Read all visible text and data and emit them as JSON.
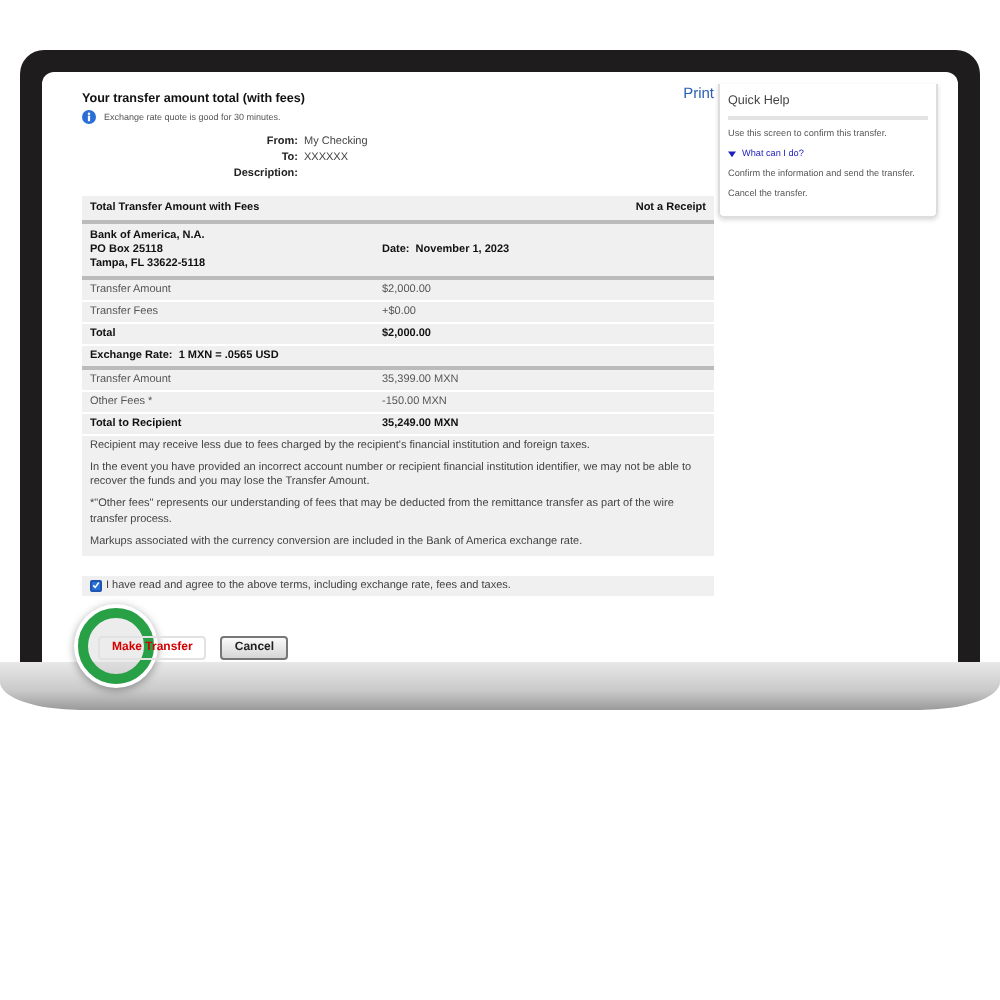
{
  "header": {
    "title": "Your transfer amount total (with fees)",
    "print_link": "Print",
    "notice": "Exchange rate quote is good for 30 minutes."
  },
  "parties": [
    {
      "label": "From:",
      "value": "My Checking"
    },
    {
      "label": "To:",
      "value": "XXXXXX"
    },
    {
      "label": "Description:"
    }
  ],
  "summary": {
    "title": "Total Transfer Amount with Fees",
    "tag": "Not a Receipt",
    "bank_lines": [
      "Bank of America, N.A.",
      "PO Box 25118",
      "Tampa, FL 33622-5118"
    ],
    "date": "Date:  November 1, 2023"
  },
  "rows": [
    {
      "kind": "line",
      "label": "Transfer Amount",
      "value": "$2,000.00"
    },
    {
      "kind": "line",
      "label": "Transfer Fees",
      "value": "+$0.00"
    },
    {
      "kind": "total",
      "label": "Total",
      "value": "$2,000.00"
    },
    {
      "kind": "section",
      "label": "Exchange Rate:  1 MXN = .0565 USD"
    },
    {
      "kind": "line",
      "label": "Transfer Amount",
      "value": "35,399.00 MXN"
    },
    {
      "kind": "line",
      "label": "Other Fees *",
      "value": "-150.00 MXN"
    },
    {
      "kind": "total",
      "label": "Total to Recipient",
      "value": "35,249.00 MXN"
    }
  ],
  "notes": [
    "Recipient may receive less due to fees charged by the recipient's financial institution and foreign taxes.",
    "In the event you have provided an incorrect account number or recipient financial institution identifier, we may not be able to recover the funds and you may lose the Transfer Amount.",
    "*\"Other fees\" represents our understanding of fees that may be deducted from the remittance transfer as part of the wire transfer process.",
    "Markups associated with the currency conversion are included in the Bank of America exchange rate."
  ],
  "agreement": {
    "checked": true,
    "label": "I have read and agree to the above terms, including exchange rate, fees and taxes."
  },
  "buttons": [
    {
      "kind": "primary",
      "label": "Make Transfer",
      "highlighted": true
    },
    {
      "kind": "secondary",
      "label": "Cancel",
      "highlighted": false
    }
  ],
  "quick_help": {
    "title": "Quick Help",
    "intro": "Use this screen to confirm this transfer.",
    "section": {
      "label": "What can I do?",
      "expanded": true
    },
    "items": [
      "Confirm the information and send the transfer.",
      "Cancel the transfer."
    ]
  }
}
